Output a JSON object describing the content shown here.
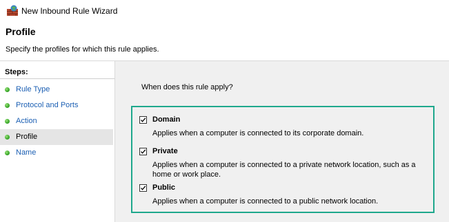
{
  "window": {
    "title": "New Inbound Rule Wizard"
  },
  "header": {
    "title": "Profile",
    "subtitle": "Specify the profiles for which this rule applies."
  },
  "sidebar": {
    "heading": "Steps:",
    "items": [
      {
        "label": "Rule Type",
        "active": false
      },
      {
        "label": "Protocol and Ports",
        "active": false
      },
      {
        "label": "Action",
        "active": false
      },
      {
        "label": "Profile",
        "active": true
      },
      {
        "label": "Name",
        "active": false
      }
    ]
  },
  "main": {
    "question": "When does this rule apply?",
    "options": [
      {
        "label": "Domain",
        "checked": true,
        "description": "Applies when a computer is connected to its corporate domain."
      },
      {
        "label": "Private",
        "checked": true,
        "description": "Applies when a computer is connected to a private network location, such as a home or work place."
      },
      {
        "label": "Public",
        "checked": true,
        "description": "Applies when a computer is connected to a public network location."
      }
    ]
  },
  "colors": {
    "highlight_border": "#1ea88c",
    "link_text": "#1b5fb3",
    "step_bullet": "#39a82a",
    "content_background": "#f0f0f0"
  },
  "icons": {
    "app": "firewall-icon",
    "step_bullet": "green-dot-icon",
    "checkbox": "checkmark-icon"
  }
}
